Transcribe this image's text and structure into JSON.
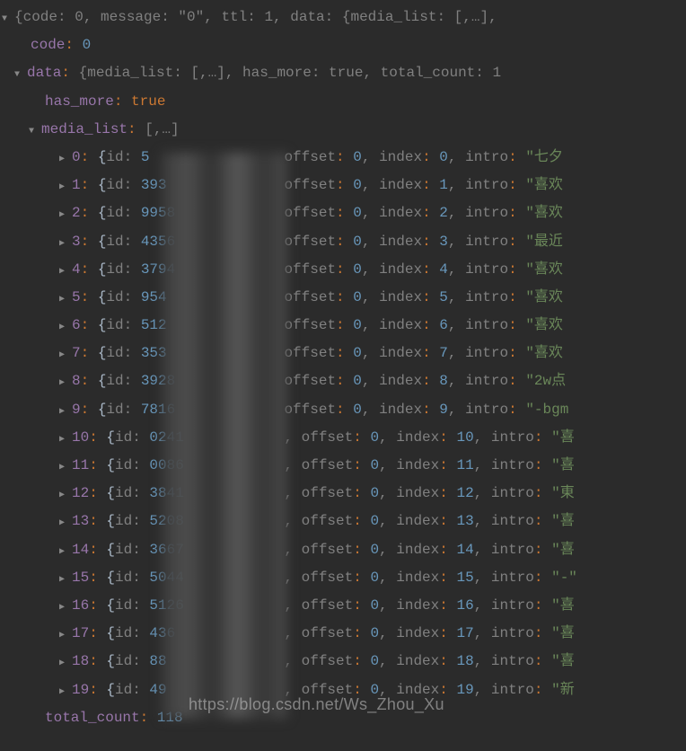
{
  "root_summary": "{code: 0, message: \"0\", ttl: 1, data: {media_list: [,…],",
  "code_key": "code",
  "code_value": "0",
  "data_key": "data",
  "data_summary": "{media_list: [,…], has_more: true, total_count: 1",
  "has_more_key": "has_more",
  "has_more_value": "true",
  "media_list_key": "media_list",
  "media_list_summary": "[,…]",
  "offset_label": "offset",
  "index_label": "index",
  "intro_label": "intro",
  "id_label": "id",
  "total_count_key": "total_count",
  "total_count_value": "118",
  "watermark": "https://blog.csdn.net/Ws_Zhou_Xu",
  "items": [
    {
      "idx": "0",
      "id": "5",
      "offset": "0",
      "index": "0",
      "intro": "\"七夕"
    },
    {
      "idx": "1",
      "id": "393",
      "offset": "0",
      "index": "1",
      "intro": "\"喜欢"
    },
    {
      "idx": "2",
      "id": "9958",
      "offset": "0",
      "index": "2",
      "intro": "\"喜欢"
    },
    {
      "idx": "3",
      "id": "4356",
      "offset": "0",
      "index": "3",
      "intro": "\"最近"
    },
    {
      "idx": "4",
      "id": "3794",
      "offset": "0",
      "index": "4",
      "intro": "\"喜欢"
    },
    {
      "idx": "5",
      "id": "954",
      "offset": "0",
      "index": "5",
      "intro": "\"喜欢"
    },
    {
      "idx": "6",
      "id": "512",
      "offset": "0",
      "index": "6",
      "intro": "\"喜欢"
    },
    {
      "idx": "7",
      "id": "353",
      "offset": "0",
      "index": "7",
      "intro": "\"喜欢"
    },
    {
      "idx": "8",
      "id": "3928",
      "offset": "0",
      "index": "8",
      "intro": "\"2w点"
    },
    {
      "idx": "9",
      "id": "7816",
      "offset": "0",
      "index": "9",
      "intro": "\"-bgm"
    },
    {
      "idx": "10",
      "id": "0241",
      "offset": "0",
      "index": "10",
      "intro": "\"喜"
    },
    {
      "idx": "11",
      "id": "0086",
      "offset": "0",
      "index": "11",
      "intro": "\"喜"
    },
    {
      "idx": "12",
      "id": "3841",
      "offset": "0",
      "index": "12",
      "intro": "\"東"
    },
    {
      "idx": "13",
      "id": "5208",
      "offset": "0",
      "index": "13",
      "intro": "\"喜"
    },
    {
      "idx": "14",
      "id": "3667",
      "offset": "0",
      "index": "14",
      "intro": "\"喜"
    },
    {
      "idx": "15",
      "id": "5044",
      "offset": "0",
      "index": "15",
      "intro": "\"-\""
    },
    {
      "idx": "16",
      "id": "5126",
      "offset": "0",
      "index": "16",
      "intro": "\"喜"
    },
    {
      "idx": "17",
      "id": "436",
      "offset": "0",
      "index": "17",
      "intro": "\"喜"
    },
    {
      "idx": "18",
      "id": "88",
      "offset": "0",
      "index": "18",
      "intro": "\"喜"
    },
    {
      "idx": "19",
      "id": "49",
      "offset": "0",
      "index": "19",
      "intro": "\"新"
    }
  ]
}
